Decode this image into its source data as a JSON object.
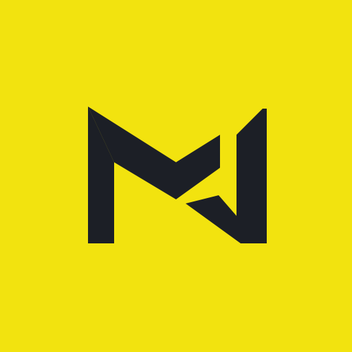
{
  "app_icon": {
    "background_color": "#F2E30F",
    "mark_color": "#1C1F26",
    "icon": "m-monogram-logo-icon"
  }
}
